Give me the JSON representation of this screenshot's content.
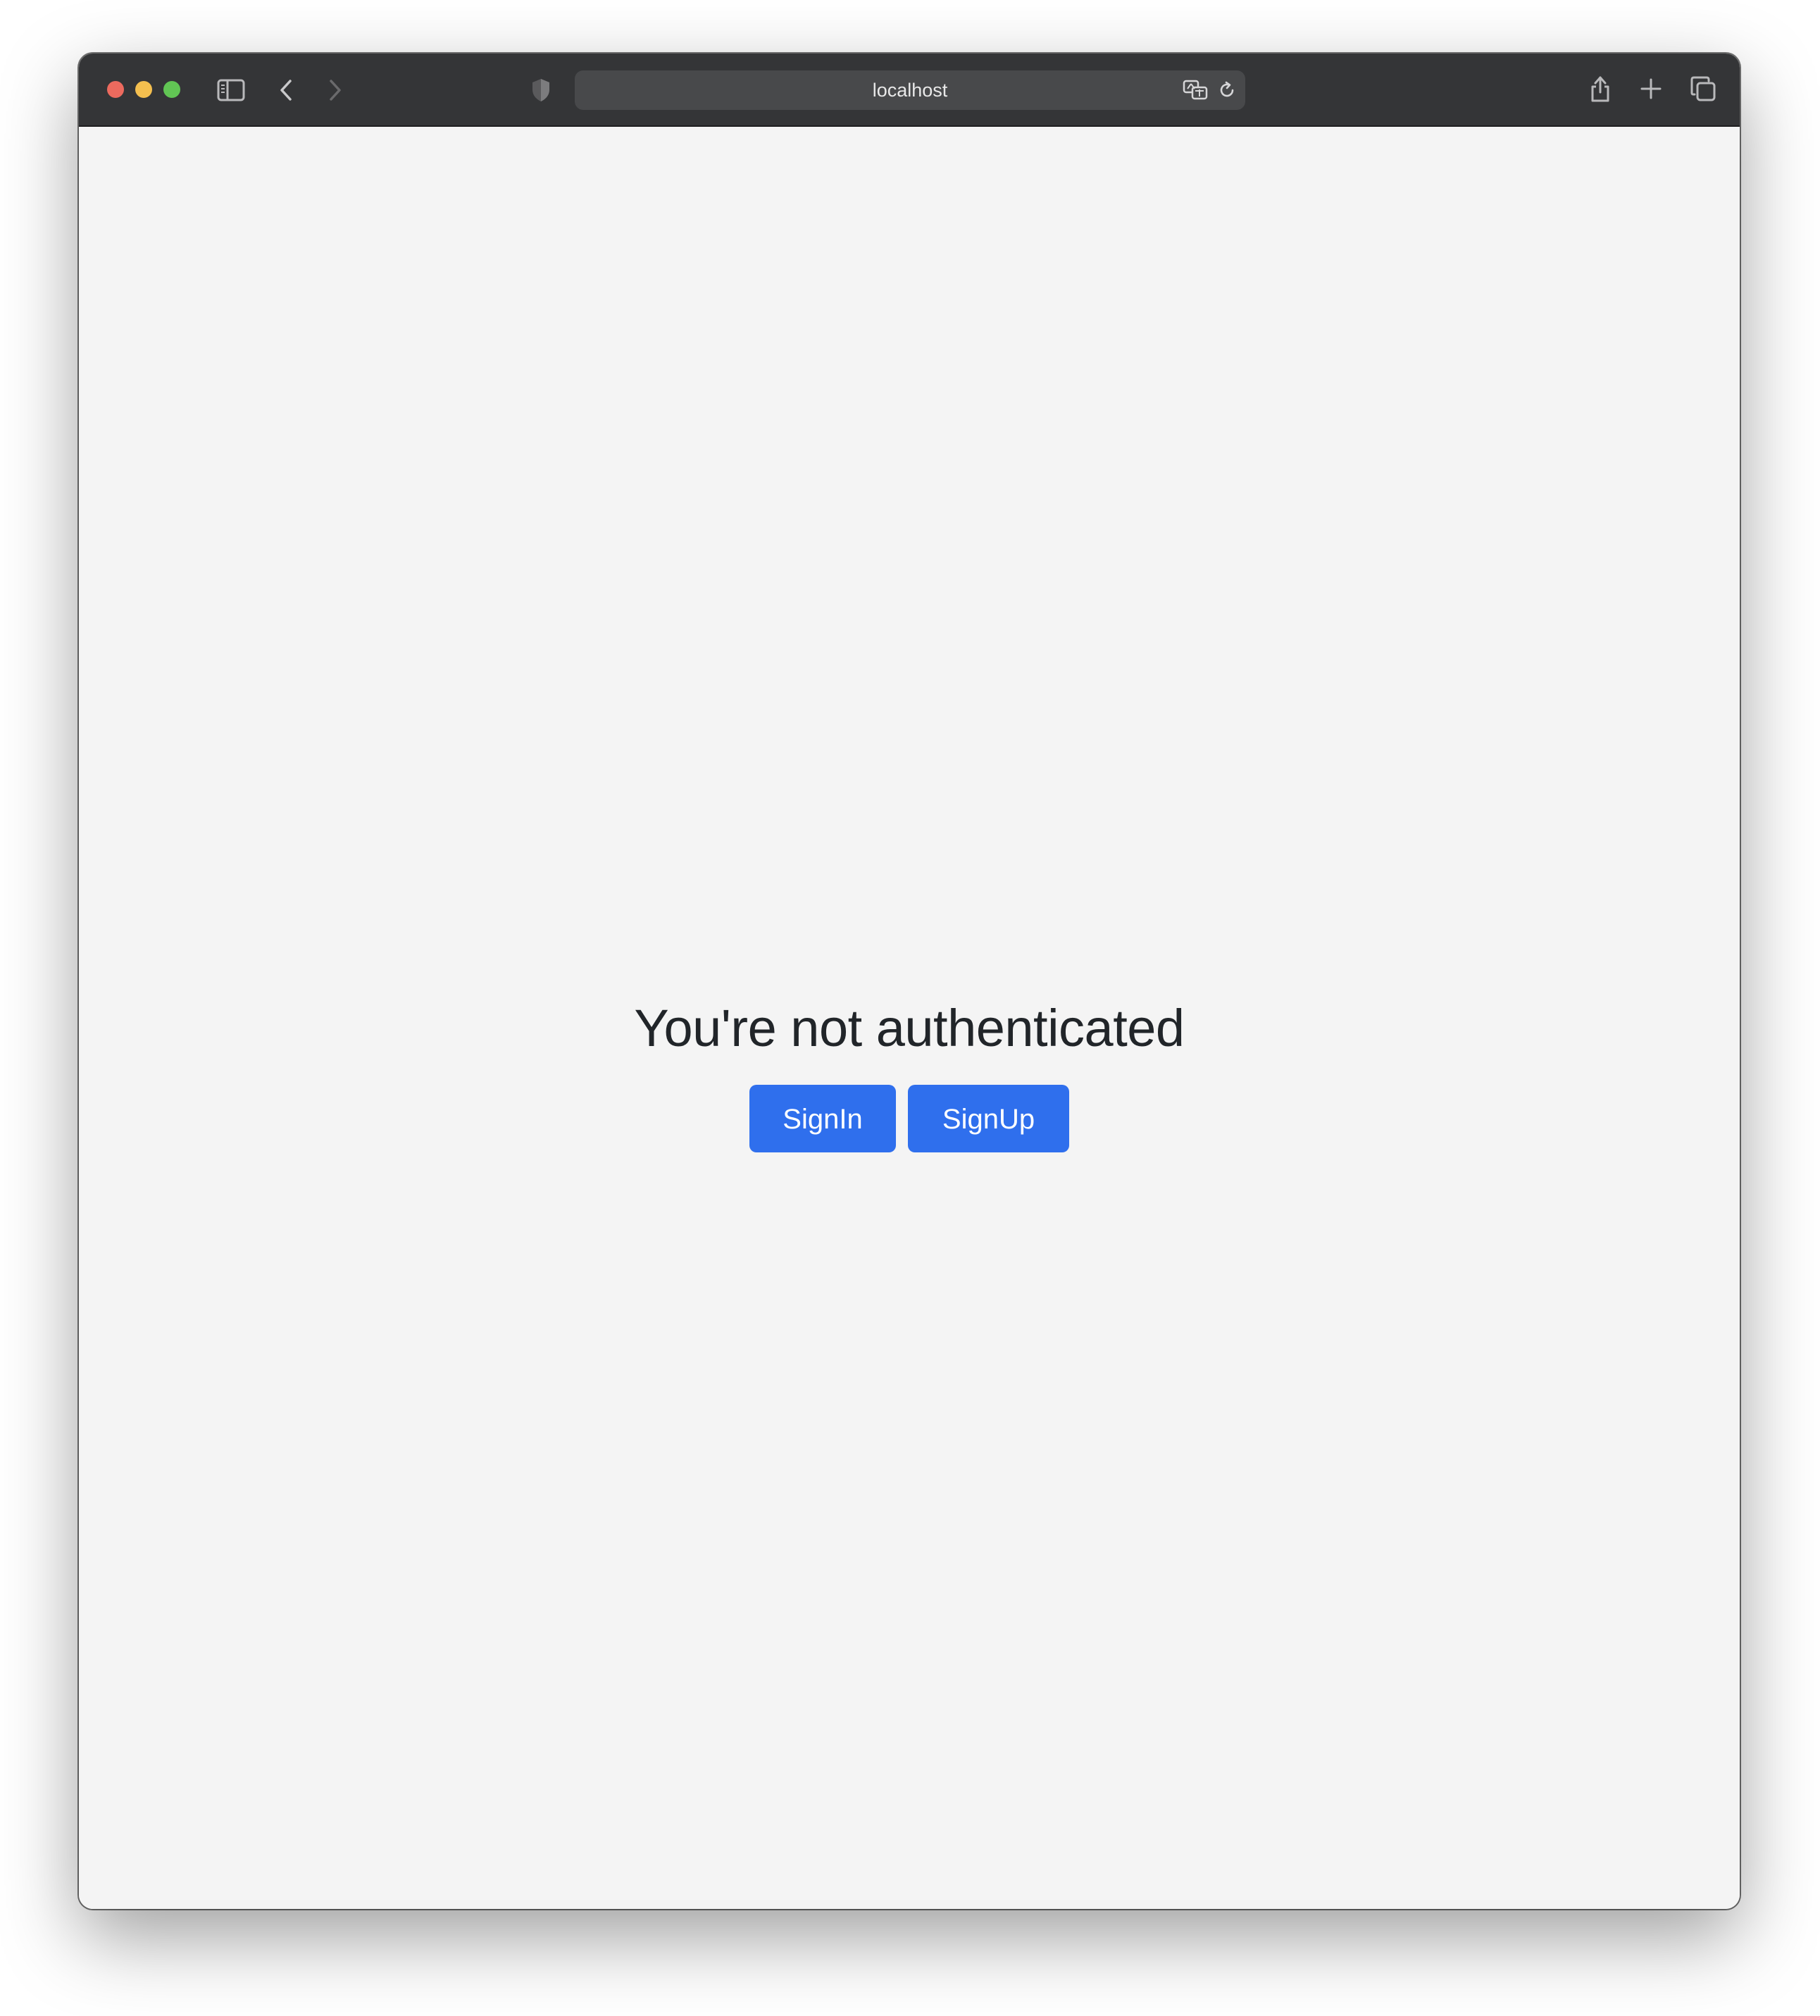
{
  "browser": {
    "url": "localhost",
    "traffic_lights": {
      "close_color": "#ec6a5e",
      "minimize_color": "#f4bf4f",
      "maximize_color": "#61c554"
    },
    "icons": {
      "sidebar": "sidebar-icon",
      "back": "chevron-left-icon",
      "forward": "chevron-right-icon",
      "privacy": "shield-icon",
      "translate": "translate-icon",
      "reload": "reload-icon",
      "share": "share-icon",
      "new_tab": "plus-icon",
      "tabs_overview": "tabs-icon"
    }
  },
  "page": {
    "heading": "You're not authenticated",
    "signin_label": "SignIn",
    "signup_label": "SignUp",
    "button_color": "#2f6fed",
    "background_color": "#f4f4f4"
  }
}
